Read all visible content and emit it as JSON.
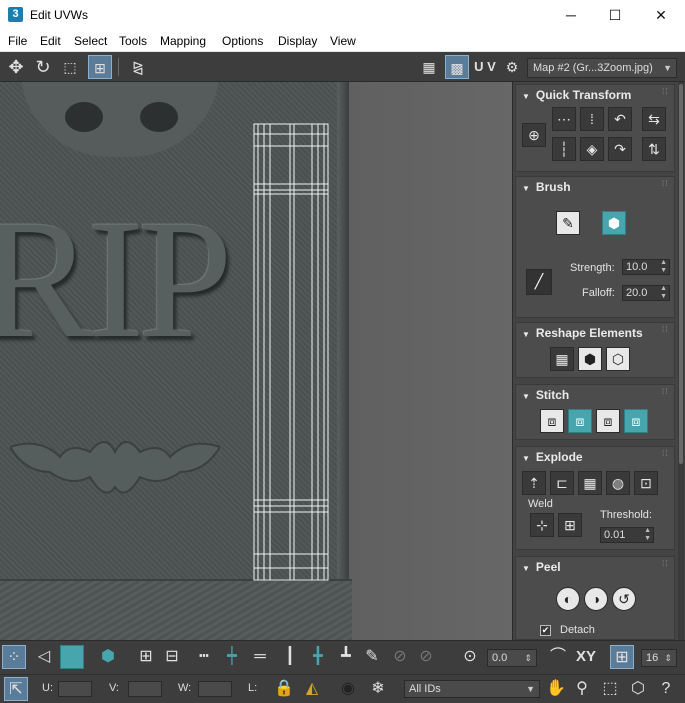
{
  "window": {
    "title": "Edit UVWs",
    "app_icon": "3",
    "controls": {
      "minimize": "─",
      "maximize": "☐",
      "close": "✕"
    }
  },
  "menu": [
    "File",
    "Edit",
    "Select",
    "Tools",
    "Mapping",
    "Options",
    "Display",
    "View"
  ],
  "toolbar": {
    "uv_label": "U V",
    "map_select": "Map #2 (Gr...3Zoom.jpg)"
  },
  "viewport": {
    "texture_text": "RIP"
  },
  "panel": {
    "quick_transform": {
      "title": "Quick Transform"
    },
    "brush": {
      "title": "Brush",
      "strength_label": "Strength:",
      "strength_value": "10.0",
      "falloff_label": "Falloff:",
      "falloff_value": "20.0"
    },
    "reshape": {
      "title": "Reshape Elements"
    },
    "stitch": {
      "title": "Stitch"
    },
    "explode": {
      "title": "Explode",
      "weld_label": "Weld",
      "threshold_label": "Threshold:",
      "threshold_value": "0.01"
    },
    "peel": {
      "title": "Peel",
      "detach_label": "Detach",
      "detach_checked": true
    }
  },
  "bottom": {
    "angle_value": "0.0",
    "xy_label": "XY",
    "grid_value": "16",
    "u_label": "U:",
    "v_label": "V:",
    "w_label": "W:",
    "l_label": "L:",
    "ids_select": "All IDs"
  },
  "colors": {
    "accent_teal": "#47a6ad",
    "active_blue": "#5b7c99",
    "panel_bg": "#444444"
  }
}
